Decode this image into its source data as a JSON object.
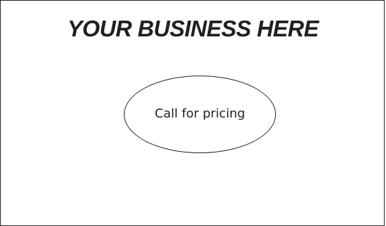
{
  "ad": {
    "headline": "YOUR BUSINESS HERE",
    "callout": "Call for pricing"
  },
  "colors": {
    "ink": "#231f20",
    "background": "#ffffff"
  }
}
